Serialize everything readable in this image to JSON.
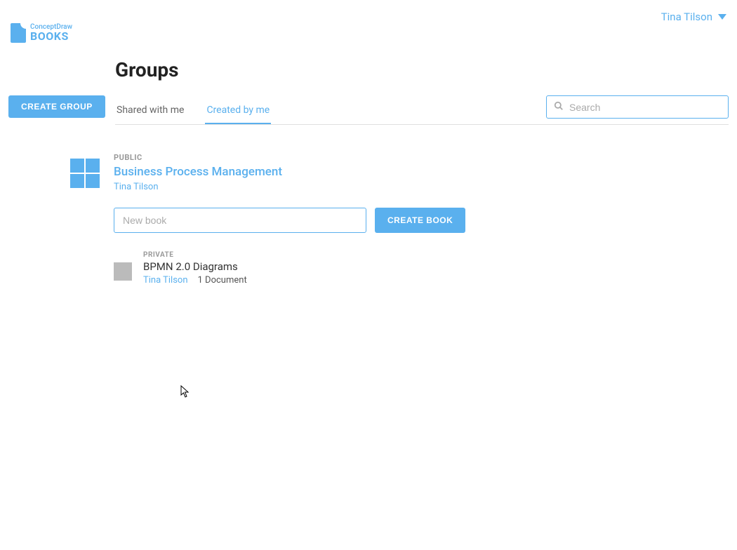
{
  "header": {
    "logo": {
      "line1": "ConceptDraw",
      "line2": "BOOKS"
    },
    "user_name": "Tina Tilson"
  },
  "sidebar": {
    "create_group_label": "CREATE GROUP"
  },
  "page": {
    "title": "Groups",
    "tabs": [
      {
        "label": "Shared with me",
        "active": false
      },
      {
        "label": "Created by me",
        "active": true
      }
    ],
    "search": {
      "placeholder": "Search",
      "value": ""
    }
  },
  "group": {
    "visibility": "PUBLIC",
    "title": "Business Process Management",
    "owner": "Tina Tilson",
    "new_book": {
      "placeholder": "New book",
      "value": ""
    },
    "create_book_label": "CREATE BOOK"
  },
  "books": [
    {
      "visibility": "PRIVATE",
      "title": "BPMN 2.0 Diagrams",
      "owner": "Tina Tilson",
      "doc_count": "1 Document"
    }
  ]
}
